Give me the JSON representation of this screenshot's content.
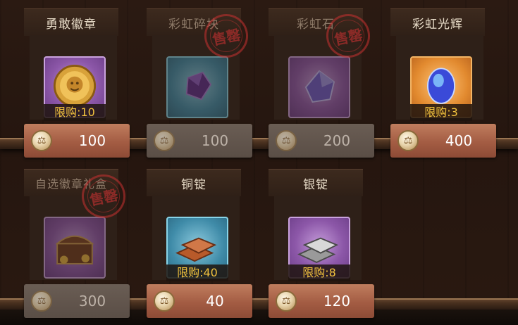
{
  "currency_icon": "scale-coin-icon",
  "sold_out_label": "售罄",
  "items": [
    {
      "name": "勇敢徽章",
      "limit": "限购:10",
      "price": "100",
      "sold_out": false,
      "icon": "lion-badge-icon",
      "frame": "purple"
    },
    {
      "name": "彩虹碎块",
      "limit": "",
      "price": "100",
      "sold_out": true,
      "icon": "purple-crystal-shard-icon",
      "frame": "blue"
    },
    {
      "name": "彩虹石",
      "limit": "",
      "price": "200",
      "sold_out": true,
      "icon": "rainbow-stone-icon",
      "frame": "purple"
    },
    {
      "name": "彩虹光辉",
      "limit": "限购:3",
      "price": "400",
      "sold_out": false,
      "icon": "glowing-gem-icon",
      "frame": "orange"
    },
    {
      "name": "自选徽章礼盒",
      "limit": "",
      "price": "300",
      "sold_out": true,
      "icon": "treasure-chest-icon",
      "frame": "purple"
    },
    {
      "name": "铜锭",
      "limit": "限购:40",
      "price": "40",
      "sold_out": false,
      "icon": "copper-ingot-icon",
      "frame": "blue"
    },
    {
      "name": "银锭",
      "limit": "限购:8",
      "price": "120",
      "sold_out": false,
      "icon": "silver-ingot-icon",
      "frame": "purple"
    }
  ]
}
